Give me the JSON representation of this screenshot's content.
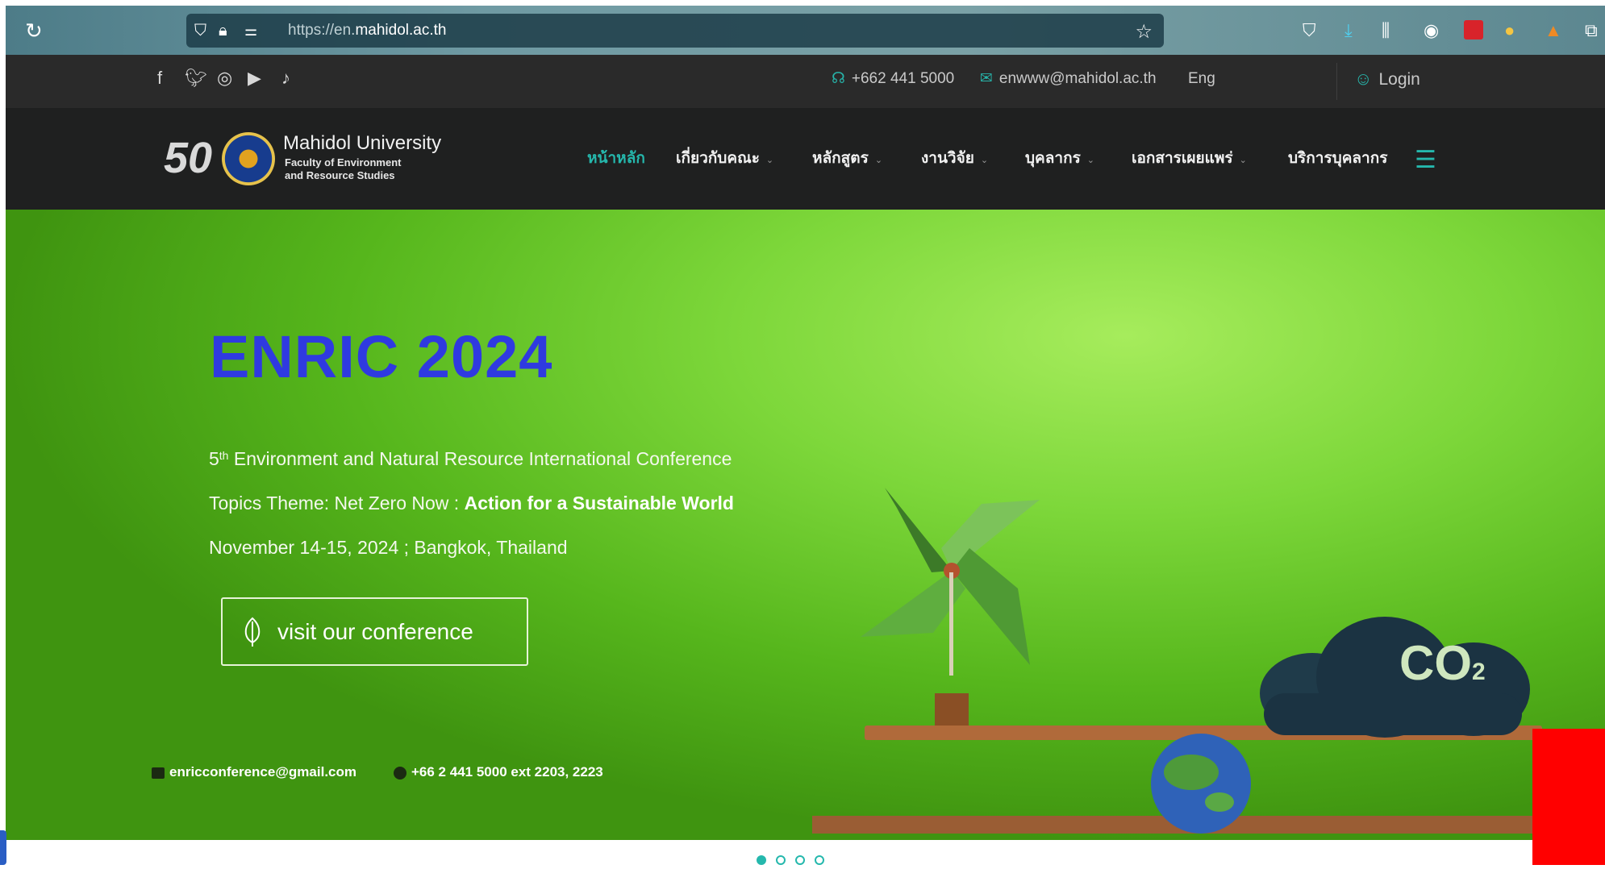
{
  "browser": {
    "url_prefix": "https://en.",
    "url_domain": "mahidol.ac.th"
  },
  "topbar": {
    "phone": "+662 441 5000",
    "email": "enwww@mahidol.ac.th",
    "language": "Eng",
    "login": "Login"
  },
  "brand": {
    "logo_mark": "50",
    "university": "Mahidol University",
    "faculty_line1": "Faculty of Environment",
    "faculty_line2": "and Resource Studies"
  },
  "nav": {
    "items": [
      {
        "label": "หน้าหลัก",
        "active": true,
        "dropdown": false
      },
      {
        "label": "เกี่ยวกับคณะ",
        "active": false,
        "dropdown": true
      },
      {
        "label": "หลักสูตร",
        "active": false,
        "dropdown": true
      },
      {
        "label": "งานวิจัย",
        "active": false,
        "dropdown": true
      },
      {
        "label": "บุคลากร",
        "active": false,
        "dropdown": true
      },
      {
        "label": "เอกสารเผยแพร่",
        "active": false,
        "dropdown": true
      },
      {
        "label": "บริการบุคลากร",
        "active": false,
        "dropdown": false
      }
    ]
  },
  "hero": {
    "title": "ENRIC 2024",
    "ordinal_num": "5",
    "ordinal_sup": "th",
    "conference_name": " Environment and Natural Resource International Conference",
    "theme_prefix": "Topics Theme: Net Zero Now : ",
    "theme_bold": "Action for a Sustainable World",
    "date_location": "November 14-15, 2024 ; Bangkok, Thailand",
    "button_label": "visit our conference",
    "contact_email": "enricconference@gmail.com",
    "contact_phone": "+66 2 441 5000 ext 2203, 2223",
    "cloud_text": "CO",
    "cloud_sub": "2"
  },
  "colors": {
    "accent": "#25b8ad",
    "title_blue": "#2f3ae0",
    "hero_green": "#6fcf2e",
    "nav_bg": "#1f2020",
    "topbar_bg": "#2a2a2a"
  },
  "carousel": {
    "slides": 4,
    "active_index": 0
  }
}
